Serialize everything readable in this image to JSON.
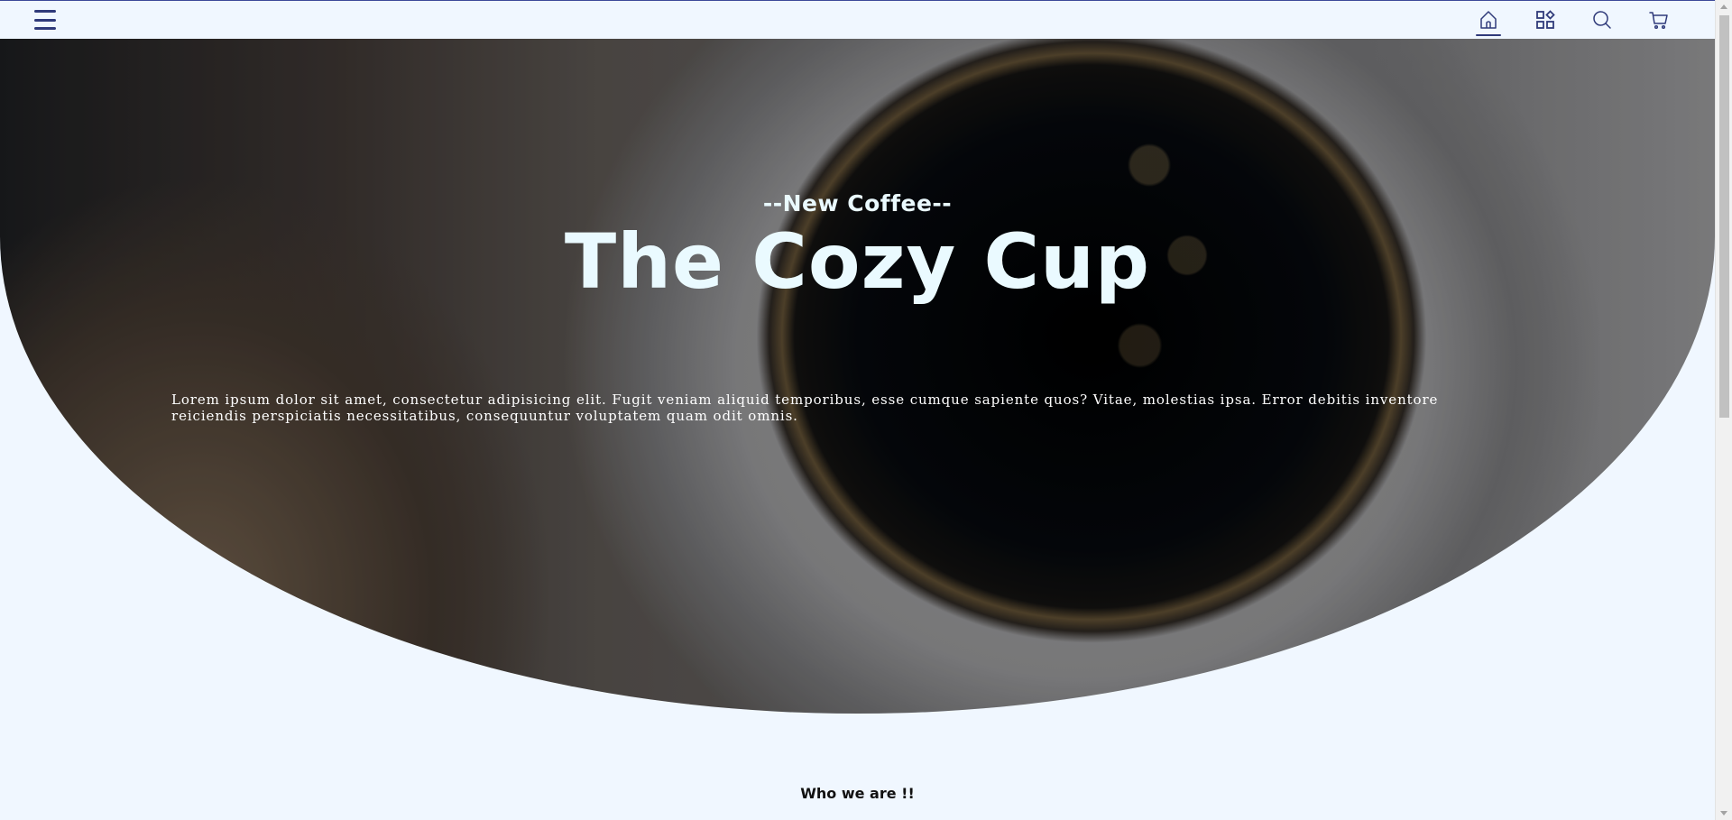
{
  "nav": {
    "menu_icon": "hamburger-menu-icon",
    "icons": [
      {
        "name": "home-icon",
        "active": true
      },
      {
        "name": "categories-icon",
        "active": false
      },
      {
        "name": "search-icon",
        "active": false
      },
      {
        "name": "cart-icon",
        "active": false
      }
    ],
    "accent_color": "#2f3a7a"
  },
  "hero": {
    "subtitle": "--New Coffee--",
    "title": "The Cozy Cup",
    "description": "Lorem ipsum dolor sit amet, consectetur adipisicing elit. Fugit veniam aliquid temporibus, esse cumque sapiente quos? Vitae, molestias ipsa. Error debitis inventore reiciendis perspiciatis necessitatibus, consequuntur voluptatem quam odit omnis."
  },
  "about": {
    "heading": "Who we are !!"
  },
  "colors": {
    "background": "#f0f7ff",
    "hero_text": "#eafaff"
  }
}
